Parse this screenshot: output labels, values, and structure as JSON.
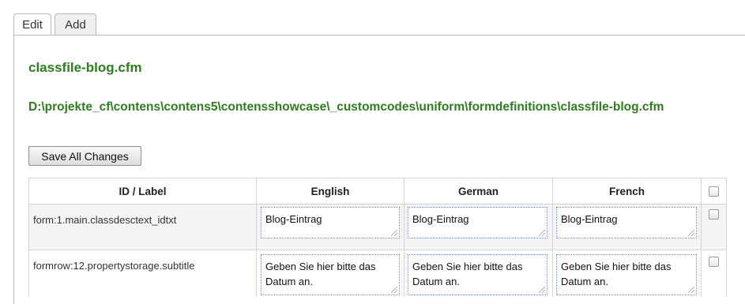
{
  "tabs": [
    {
      "label": "Edit",
      "active": true
    },
    {
      "label": "Add",
      "active": false
    }
  ],
  "file": {
    "title": "classfile-blog.cfm",
    "path": "D:\\projekte_cf\\contens\\contens5\\contensshowcase\\_customcodes\\uniform\\formdefinitions\\classfile-blog.cfm"
  },
  "toolbar": {
    "save_all_label": "Save All Changes"
  },
  "table": {
    "headers": [
      "ID / Label",
      "English",
      "German",
      "French"
    ],
    "rows": [
      {
        "id": "form:1.main.classdesctext_idtxt",
        "english": "Blog-Eintrag",
        "german": "Blog-Eintrag",
        "french": "Blog-Eintrag",
        "checked": false
      },
      {
        "id": "formrow:12.propertystorage.subtitle",
        "english": "Geben Sie hier bitte das Datum an.",
        "german": "Geben Sie hier bitte das Datum an.",
        "french": "Geben Sie hier bitte das Datum an.",
        "checked": false
      }
    ]
  },
  "colors": {
    "title_green": "#2e7d1f",
    "border": "#d4d4d4",
    "row_stripe": "#f4f4f4"
  }
}
